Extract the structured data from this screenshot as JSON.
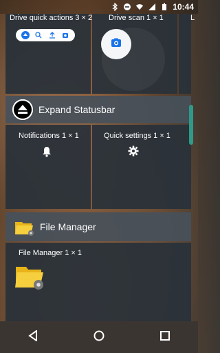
{
  "status": {
    "time": "10:44"
  },
  "top_row": {
    "drive_quick_actions": "Drive quick actions  3 × 2",
    "drive_scan": "Drive scan  1 × 1",
    "partial_label": "L"
  },
  "expand_statusbar": {
    "title": "Expand Statusbar",
    "notifications_label": "Notifications  1 × 1",
    "quick_settings_label": "Quick settings  1 × 1"
  },
  "file_manager": {
    "title": "File Manager",
    "widget_label": "File Manager  1 × 1"
  },
  "icons": {
    "bluetooth": "bluetooth-icon",
    "wifi": "wifi-icon",
    "signal": "signal-icon",
    "battery": "battery-icon",
    "eject": "eject-icon",
    "bell": "bell-icon",
    "gear": "gear-icon",
    "folder": "folder-icon",
    "camera": "camera-icon",
    "back": "back-icon",
    "home": "home-icon",
    "recents": "recents-icon"
  },
  "colors": {
    "panel": "#28313a",
    "header": "#46505a",
    "accent": "#2e9a8a",
    "drive_blue": "#1a73e8"
  }
}
